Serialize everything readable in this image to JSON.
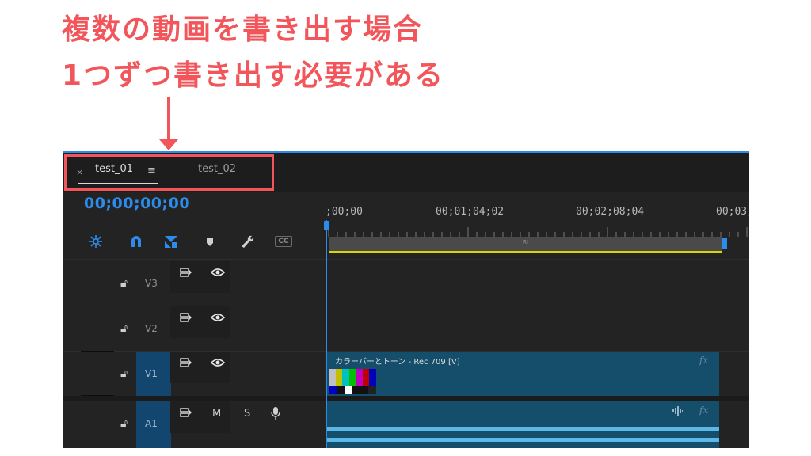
{
  "annotation": {
    "line1": "複数の動画を書き出す場合",
    "line2": "1つずつ書き出す必要がある",
    "color": "#f2555a"
  },
  "tabs": [
    {
      "label": "test_01",
      "active": true
    },
    {
      "label": "test_02",
      "active": false
    }
  ],
  "tab_close_glyph": "×",
  "tab_menu_glyph": "≡",
  "timecode": "00;00;00;00",
  "ruler": {
    "times": [
      ";00;00",
      "00;01;04;02",
      "00;02;08;04",
      "00;03;"
    ],
    "work_area_label": "RI"
  },
  "toolbar": {
    "icons": [
      "snap-icon",
      "magnet-icon",
      "linked-selection-icon",
      "marker-icon",
      "wrench-icon",
      "captions-icon"
    ],
    "captions_label": "CC"
  },
  "tracks": {
    "video": [
      {
        "name": "V3",
        "targeted": false
      },
      {
        "name": "V2",
        "targeted": false
      },
      {
        "name": "V1",
        "targeted": true
      }
    ],
    "audio": [
      {
        "name": "A1",
        "targeted": true,
        "mute_label": "M",
        "solo_label": "S"
      }
    ]
  },
  "clips": {
    "video": {
      "track": "V1",
      "title": "カラーバーとトーン - Rec 709 [V]",
      "fx_label": "fx"
    },
    "audio": {
      "track": "A1",
      "fx_label": "fx"
    }
  },
  "colors": {
    "accent_blue": "#2d8ceb",
    "clip_fill": "#144e6b",
    "panel_bg": "#232323"
  }
}
